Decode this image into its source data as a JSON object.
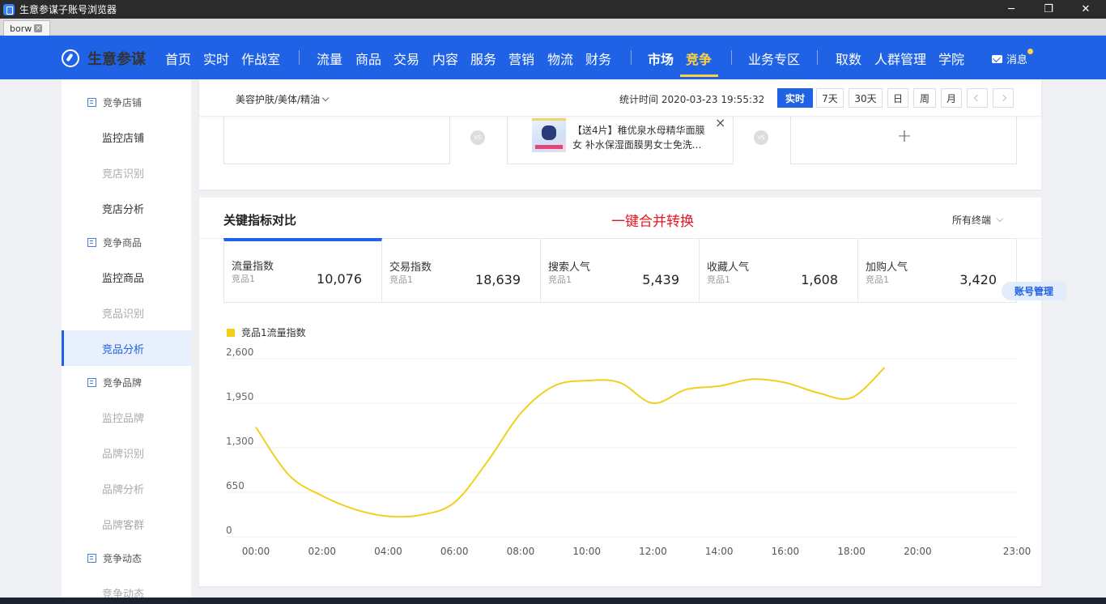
{
  "window": {
    "title": "生意参谋子账号浏览器",
    "tab_label": "borw",
    "minimize_icon": "─",
    "restore_icon": "❐",
    "close_icon": "✕"
  },
  "nav": {
    "logo": "生意参谋",
    "items": [
      {
        "label": "首页",
        "x": 204
      },
      {
        "label": "实时",
        "x": 251
      },
      {
        "label": "作战室",
        "x": 298
      }
    ],
    "items_mid": [
      "流量",
      "商品",
      "交易",
      "内容",
      "服务",
      "营销",
      "物流",
      "财务"
    ],
    "market": "市场",
    "compete": "竞争",
    "business_zone": "业务专区",
    "data_items": [
      "取数",
      "人群管理",
      "学院"
    ],
    "message": "消息"
  },
  "sidebar": {
    "groups": [
      {
        "label": "竞争店铺",
        "items": [
          {
            "label": "监控店铺",
            "state": "normal"
          },
          {
            "label": "竞店识别",
            "state": "muted"
          },
          {
            "label": "竞店分析",
            "state": "normal"
          }
        ]
      },
      {
        "label": "竞争商品",
        "items": [
          {
            "label": "监控商品",
            "state": "normal"
          },
          {
            "label": "竞品识别",
            "state": "muted"
          },
          {
            "label": "竞品分析",
            "state": "active"
          }
        ]
      },
      {
        "label": "竞争品牌",
        "items": [
          {
            "label": "监控品牌",
            "state": "muted"
          },
          {
            "label": "品牌识别",
            "state": "muted"
          },
          {
            "label": "品牌分析",
            "state": "muted"
          },
          {
            "label": "品牌客群",
            "state": "muted"
          }
        ]
      },
      {
        "label": "竞争动态",
        "items": [
          {
            "label": "竞争动态",
            "state": "muted"
          }
        ]
      }
    ]
  },
  "filter": {
    "category": "美容护肤/美体/精油",
    "stat_time": "统计时间 2020-03-23 19:55:32",
    "time_buttons": [
      "实时",
      "7天",
      "30天",
      "日",
      "周",
      "月"
    ],
    "active_time": "实时"
  },
  "compare": {
    "vs": "VS",
    "product_title": "【送4片】稚优泉水母精华面膜女 补水保湿面膜男女士免洗...",
    "add": "+"
  },
  "metrics_panel": {
    "title": "关键指标对比",
    "merge_label": "一键合并转换",
    "terminal": "所有终端",
    "cards": [
      {
        "name": "流量指数",
        "sub": "竞品1",
        "value": "10,076"
      },
      {
        "name": "交易指数",
        "sub": "竞品1",
        "value": "18,639"
      },
      {
        "name": "搜索人气",
        "sub": "竞品1",
        "value": "5,439"
      },
      {
        "name": "收藏人气",
        "sub": "竞品1",
        "value": "1,608"
      },
      {
        "name": "加购人气",
        "sub": "竞品1",
        "value": "3,420"
      }
    ],
    "account_tag": "账号管理"
  },
  "chart_data": {
    "type": "line",
    "legend": "竞品1流量指数",
    "series_color": "#f2cf1f",
    "ylim": [
      0,
      2600
    ],
    "yticks": [
      0,
      650,
      1300,
      1950,
      2600
    ],
    "ytick_labels": [
      "0",
      "650",
      "1,300",
      "1,950",
      "2,600"
    ],
    "x_labels": [
      "00:00",
      "02:00",
      "04:00",
      "06:00",
      "08:00",
      "10:00",
      "12:00",
      "14:00",
      "16:00",
      "18:00",
      "20:00",
      "23:00"
    ],
    "x_label_hours": [
      0,
      2,
      4,
      6,
      8,
      10,
      12,
      14,
      16,
      18,
      20,
      23
    ],
    "series": [
      {
        "name": "竞品1流量指数",
        "x": [
          0,
          1,
          2,
          3,
          4,
          5,
          6,
          7,
          8,
          9,
          10,
          11,
          12,
          13,
          14,
          15,
          16,
          17,
          18,
          19
        ],
        "values": [
          1600,
          900,
          600,
          400,
          300,
          320,
          500,
          1100,
          1800,
          2200,
          2280,
          2250,
          1950,
          2150,
          2200,
          2300,
          2250,
          2100,
          2030,
          2470
        ]
      }
    ],
    "grid": true
  }
}
